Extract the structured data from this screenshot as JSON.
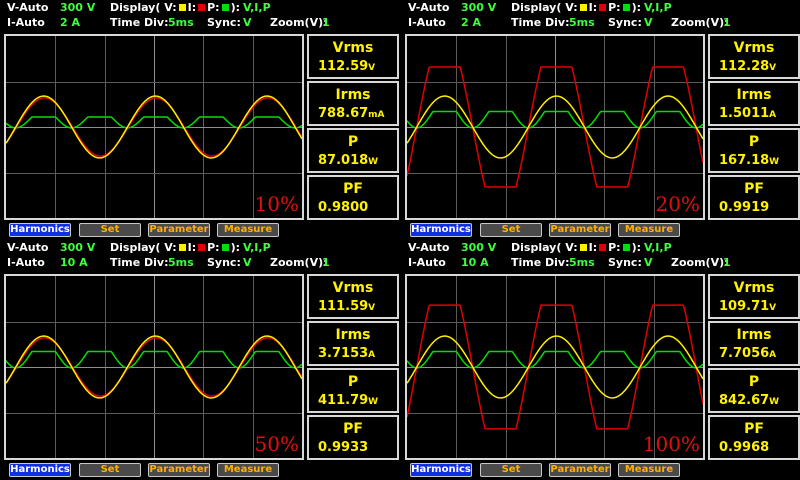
{
  "colors": {
    "voltage": "#fff000",
    "current": "#e00000",
    "power": "#00e000",
    "readout": "#fff200"
  },
  "panels": [
    {
      "v_mode": "V-Auto",
      "v_range": "300 V",
      "i_mode": "I-Auto",
      "i_range": "2 A",
      "display_label": "Display( V:",
      "display_i": "I:",
      "display_p": "P:",
      "display_close": "):",
      "display_value": "V,I,P",
      "time_div_label": "Time  Div:",
      "time_div": "5ms",
      "sync_label": "Sync:",
      "sync": "V",
      "zoom_label": "Zoom(V):",
      "zoom": "1",
      "percent": "10%",
      "wave": {
        "v_amp": 0.17,
        "i_amp": 0.16,
        "i_shape": "sine",
        "p_amp": 0.06
      },
      "readings": [
        {
          "name": "Vrms",
          "value": "112.59",
          "unit": "V"
        },
        {
          "name": "Irms",
          "value": "788.67",
          "unit": "mA"
        },
        {
          "name": "P",
          "value": "87.018",
          "unit": "W"
        },
        {
          "name": "PF",
          "value": "0.9800",
          "unit": ""
        }
      ],
      "buttons": [
        "Harmonics",
        "Set",
        "Parameter",
        "Measure"
      ]
    },
    {
      "v_mode": "V-Auto",
      "v_range": "300 V",
      "i_mode": "I-Auto",
      "i_range": "2 A",
      "display_label": "Display( V:",
      "display_i": "I:",
      "display_p": "P:",
      "display_close": "):",
      "display_value": "V,I,P",
      "time_div_label": "Time  Div:",
      "time_div": "5ms",
      "sync_label": "Sync:",
      "sync": "V",
      "zoom_label": "Zoom(V):",
      "zoom": "1",
      "percent": "20%",
      "wave": {
        "v_amp": 0.17,
        "i_amp": 0.33,
        "i_shape": "flat",
        "p_amp": 0.09
      },
      "readings": [
        {
          "name": "Vrms",
          "value": "112.28",
          "unit": "V"
        },
        {
          "name": "Irms",
          "value": "1.5011",
          "unit": "A"
        },
        {
          "name": "P",
          "value": "167.18",
          "unit": "W"
        },
        {
          "name": "PF",
          "value": "0.9919",
          "unit": ""
        }
      ],
      "buttons": [
        "Harmonics",
        "Set",
        "Parameter",
        "Measure"
      ]
    },
    {
      "v_mode": "V-Auto",
      "v_range": "300 V",
      "i_mode": "I-Auto",
      "i_range": "10 A",
      "display_label": "Display( V:",
      "display_i": "I:",
      "display_p": "P:",
      "display_close": "):",
      "display_value": "V,I,P",
      "time_div_label": "Time  Div:",
      "time_div": "5ms",
      "sync_label": "Sync:",
      "sync": "V",
      "zoom_label": "Zoom(V):",
      "zoom": "1",
      "percent": "50%",
      "wave": {
        "v_amp": 0.17,
        "i_amp": 0.16,
        "i_shape": "sine",
        "p_amp": 0.09
      },
      "readings": [
        {
          "name": "Vrms",
          "value": "111.59",
          "unit": "V"
        },
        {
          "name": "Irms",
          "value": "3.7153",
          "unit": "A"
        },
        {
          "name": "P",
          "value": "411.79",
          "unit": "W"
        },
        {
          "name": "PF",
          "value": "0.9933",
          "unit": ""
        }
      ],
      "buttons": [
        "Harmonics",
        "Set",
        "Parameter",
        "Measure"
      ]
    },
    {
      "v_mode": "V-Auto",
      "v_range": "300 V",
      "i_mode": "I-Auto",
      "i_range": "10 A",
      "display_label": "Display( V:",
      "display_i": "I:",
      "display_p": "P:",
      "display_close": "):",
      "display_value": "V,I,P",
      "time_div_label": "Time  Div:",
      "time_div": "5ms",
      "sync_label": "Sync:",
      "sync": "V",
      "zoom_label": "Zoom(V):",
      "zoom": "1",
      "percent": "100%",
      "wave": {
        "v_amp": 0.17,
        "i_amp": 0.34,
        "i_shape": "flat",
        "p_amp": 0.09
      },
      "readings": [
        {
          "name": "Vrms",
          "value": "109.71",
          "unit": "V"
        },
        {
          "name": "Irms",
          "value": "7.7056",
          "unit": "A"
        },
        {
          "name": "P",
          "value": "842.67",
          "unit": "W"
        },
        {
          "name": "PF",
          "value": "0.9968",
          "unit": ""
        }
      ],
      "buttons": [
        "Harmonics",
        "Set",
        "Parameter",
        "Measure"
      ]
    }
  ]
}
